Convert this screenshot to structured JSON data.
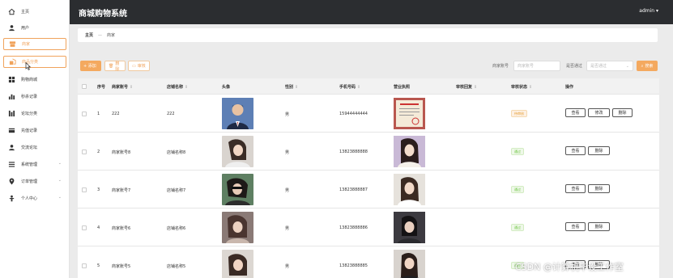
{
  "header": {
    "title": "商城购物系统",
    "user": "admin ▾"
  },
  "sidebar": {
    "items": [
      {
        "label": "主页",
        "icon": "home-icon"
      },
      {
        "label": "用户",
        "icon": "user-icon"
      },
      {
        "label": "商家",
        "icon": "store-icon"
      },
      {
        "label": "商品分类",
        "icon": "category-icon"
      },
      {
        "label": "购物商城",
        "icon": "grid-icon"
      },
      {
        "label": "秒杀记录",
        "icon": "bar-chart-icon"
      },
      {
        "label": "论坛分类",
        "icon": "columns-icon"
      },
      {
        "label": "充值记录",
        "icon": "card-icon"
      },
      {
        "label": "交流论坛",
        "icon": "user-icon"
      },
      {
        "label": "系统管理",
        "icon": "list-icon"
      },
      {
        "label": "订单管理",
        "icon": "location-icon"
      },
      {
        "label": "个人中心",
        "icon": "person-icon"
      }
    ]
  },
  "breadcrumb": {
    "home": "主页",
    "separator": "—",
    "current": "商家"
  },
  "toolbar": {
    "add": "+ 添加",
    "delete": "删除",
    "audit": "审核",
    "filter_account_label": "商家账号",
    "filter_account_placeholder": "商家账号",
    "filter_pass_label": "是否通过",
    "filter_pass_placeholder": "是否通过",
    "search": "搜索"
  },
  "table": {
    "headers": {
      "index": "序号",
      "account": "商家账号",
      "shop": "店铺名称",
      "avatar": "头像",
      "gender": "性别",
      "phone": "手机号码",
      "license": "营业执照",
      "reply": "审核回复",
      "audit_status": "审核状态",
      "ops": "操作"
    },
    "rows": [
      {
        "index": "1",
        "account": "222",
        "shop": "222",
        "gender": "男",
        "phone": "15944444444",
        "status": "待审核",
        "status_kind": "pending",
        "actions": [
          "查看",
          "修改",
          "删除"
        ]
      },
      {
        "index": "2",
        "account": "商家账号8",
        "shop": "店铺名称8",
        "gender": "男",
        "phone": "13823888888",
        "status": "通过",
        "status_kind": "pass",
        "actions": [
          "查看",
          "删除"
        ]
      },
      {
        "index": "3",
        "account": "商家账号7",
        "shop": "店铺名称7",
        "gender": "男",
        "phone": "13823888887",
        "status": "通过",
        "status_kind": "pass",
        "actions": [
          "查看",
          "删除"
        ]
      },
      {
        "index": "4",
        "account": "商家账号6",
        "shop": "店铺名称6",
        "gender": "男",
        "phone": "13823888886",
        "status": "通过",
        "status_kind": "pass",
        "actions": [
          "查看",
          "删除"
        ]
      },
      {
        "index": "5",
        "account": "商家账号5",
        "shop": "店铺名称5",
        "gender": "男",
        "phone": "13823888885",
        "status": "通过",
        "status_kind": "pass",
        "actions": [
          "查看",
          "删除"
        ]
      }
    ]
  },
  "watermark": "CSDN @计算机毕设工作室",
  "colors": {
    "accent": "#f4a95f",
    "header_bg": "#2b2d30",
    "pass": "#67c23a",
    "pending": "#e6a23c"
  }
}
